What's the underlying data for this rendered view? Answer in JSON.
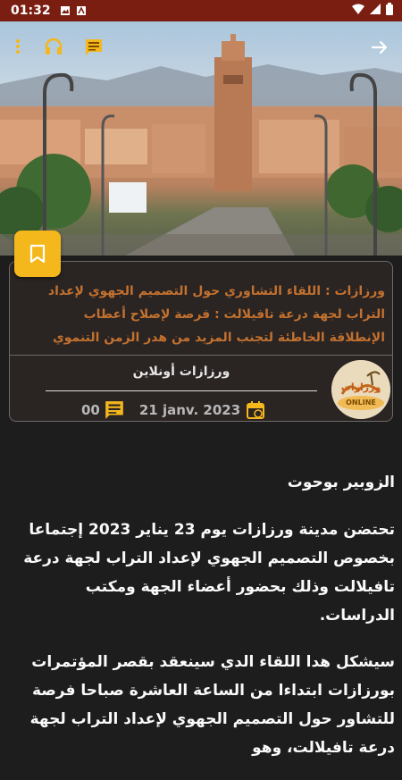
{
  "status_bar": {
    "time": "01:32"
  },
  "post": {
    "title": "ورزازات : اللقاء التشاوري حول التصميم الجهوي لإعداد التراب لجهة درعة تافيلالت : فرصة لإصلاح أعطاب الإنطلاقة الخاطئة لتجنب المزيد من هدر الزمن التنموي",
    "source": "ورزازات أونلاين",
    "date": "21 janv. 2023",
    "comments_count": "00",
    "logo_text": "ورزازات",
    "logo_sub": "ONLINE"
  },
  "article": {
    "author": "الزوبير بوحوت",
    "paragraphs": [
      "تحتضن مدينة ورزازات يوم 23 يناير 2023 إجتماعا بخصوص التصميم الجهوي لإعداد التراب لجهة درعة تافيلالت وذلك بحضور أعضاء الجهة ومكتب الدراسات.",
      "سيشكل هدا اللقاء الدي سينعقد بقصر المؤتمرات بورزازات ابتداءا من الساعة العاشرة صباحا فرصة للتشاور حول التصميم الجهوي لإعداد التراب لجهة درعة تافيلالت، وهو"
    ]
  },
  "colors": {
    "accent": "#f4b71c",
    "status_bar": "#7a1e12",
    "title": "#c2712f",
    "background": "#1d1d1d"
  },
  "icons": [
    "more-vert-icon",
    "headphones-icon",
    "comment-icon",
    "share-arrow-icon",
    "bookmark-icon",
    "calendar-icon",
    "comments-icon"
  ]
}
